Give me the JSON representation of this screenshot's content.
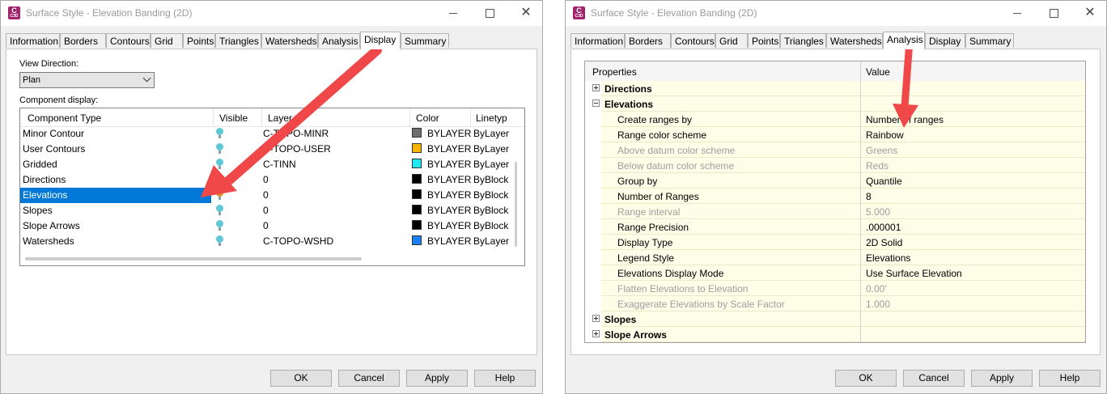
{
  "left_window": {
    "title": "Surface Style - Elevation Banding (2D)",
    "tabs": [
      "Information",
      "Borders",
      "Contours",
      "Grid",
      "Points",
      "Triangles",
      "Watersheds",
      "Analysis",
      "Display",
      "Summary"
    ],
    "active_tab": "Display",
    "view_direction_label": "View Direction:",
    "view_direction_value": "Plan",
    "component_display_label": "Component display:",
    "columns": [
      "Component Type",
      "Visible",
      "Layer",
      "Color",
      "Linetyp"
    ],
    "rows": [
      {
        "type": "Minor Contour",
        "visible": true,
        "layer": "C-TOPO-MINR",
        "color": "BYLAYER",
        "swatch": "#6e6e6e",
        "linetype": "ByLayer"
      },
      {
        "type": "User Contours",
        "visible": true,
        "layer": "C-TOPO-USER",
        "color": "BYLAYER",
        "swatch": "#f5b400",
        "linetype": "ByLayer"
      },
      {
        "type": "Gridded",
        "visible": true,
        "layer": "C-TINN",
        "color": "BYLAYER",
        "swatch": "#1ee8f0",
        "linetype": "ByLayer"
      },
      {
        "type": "Directions",
        "visible": true,
        "layer": "0",
        "color": "BYLAYER",
        "swatch": "#000000",
        "linetype": "ByBlock"
      },
      {
        "type": "Elevations",
        "visible": false,
        "layer": "0",
        "color": "BYLAYER",
        "swatch": "#000000",
        "linetype": "ByBlock"
      },
      {
        "type": "Slopes",
        "visible": true,
        "layer": "0",
        "color": "BYLAYER",
        "swatch": "#000000",
        "linetype": "ByBlock"
      },
      {
        "type": "Slope Arrows",
        "visible": true,
        "layer": "0",
        "color": "BYLAYER",
        "swatch": "#000000",
        "linetype": "ByBlock"
      },
      {
        "type": "Watersheds",
        "visible": true,
        "layer": "C-TOPO-WSHD",
        "color": "BYLAYER",
        "swatch": "#1a7ff0",
        "linetype": "ByLayer"
      }
    ],
    "selected_row": "Elevations",
    "buttons": {
      "ok": "OK",
      "cancel": "Cancel",
      "apply": "Apply",
      "help": "Help"
    }
  },
  "right_window": {
    "title": "Surface Style - Elevation Banding (2D)",
    "tabs": [
      "Information",
      "Borders",
      "Contours",
      "Grid",
      "Points",
      "Triangles",
      "Watersheds",
      "Analysis",
      "Display",
      "Summary"
    ],
    "active_tab": "Analysis",
    "headers": {
      "property": "Properties",
      "value": "Value"
    },
    "rows": [
      {
        "kind": "group",
        "expanded": false,
        "label": "Directions",
        "value": ""
      },
      {
        "kind": "group",
        "expanded": true,
        "label": "Elevations",
        "value": ""
      },
      {
        "kind": "prop",
        "enabled": true,
        "label": "Create ranges by",
        "value": "Number of ranges"
      },
      {
        "kind": "prop",
        "enabled": true,
        "label": "Range color scheme",
        "value": "Rainbow"
      },
      {
        "kind": "prop",
        "enabled": false,
        "label": "Above datum color scheme",
        "value": "Greens"
      },
      {
        "kind": "prop",
        "enabled": false,
        "label": "Below datum color scheme",
        "value": "Reds"
      },
      {
        "kind": "prop",
        "enabled": true,
        "label": "Group by",
        "value": "Quantile"
      },
      {
        "kind": "prop",
        "enabled": true,
        "label": "Number of Ranges",
        "value": "8"
      },
      {
        "kind": "prop",
        "enabled": false,
        "label": "Range interval",
        "value": "5.000"
      },
      {
        "kind": "prop",
        "enabled": true,
        "label": "Range Precision",
        "value": ".000001"
      },
      {
        "kind": "prop",
        "enabled": true,
        "label": "Display Type",
        "value": "2D Solid"
      },
      {
        "kind": "prop",
        "enabled": true,
        "label": "Legend Style",
        "value": "Elevations"
      },
      {
        "kind": "prop",
        "enabled": true,
        "label": "Elevations Display Mode",
        "value": "Use Surface Elevation"
      },
      {
        "kind": "prop",
        "enabled": false,
        "label": "Flatten Elevations to Elevation",
        "value": "0.00'"
      },
      {
        "kind": "prop",
        "enabled": false,
        "label": "Exaggerate Elevations by Scale Factor",
        "value": "1.000"
      },
      {
        "kind": "group",
        "expanded": false,
        "label": "Slopes",
        "value": ""
      },
      {
        "kind": "group",
        "expanded": false,
        "label": "Slope Arrows",
        "value": ""
      }
    ],
    "buttons": {
      "ok": "OK",
      "cancel": "Cancel",
      "apply": "Apply",
      "help": "Help"
    }
  },
  "colors": {
    "accent": "#0078d7",
    "annotation_arrow": "#f04848",
    "app_icon": "#a1256d"
  },
  "app_icon_text": "C",
  "app_icon_subtext": "C3D"
}
